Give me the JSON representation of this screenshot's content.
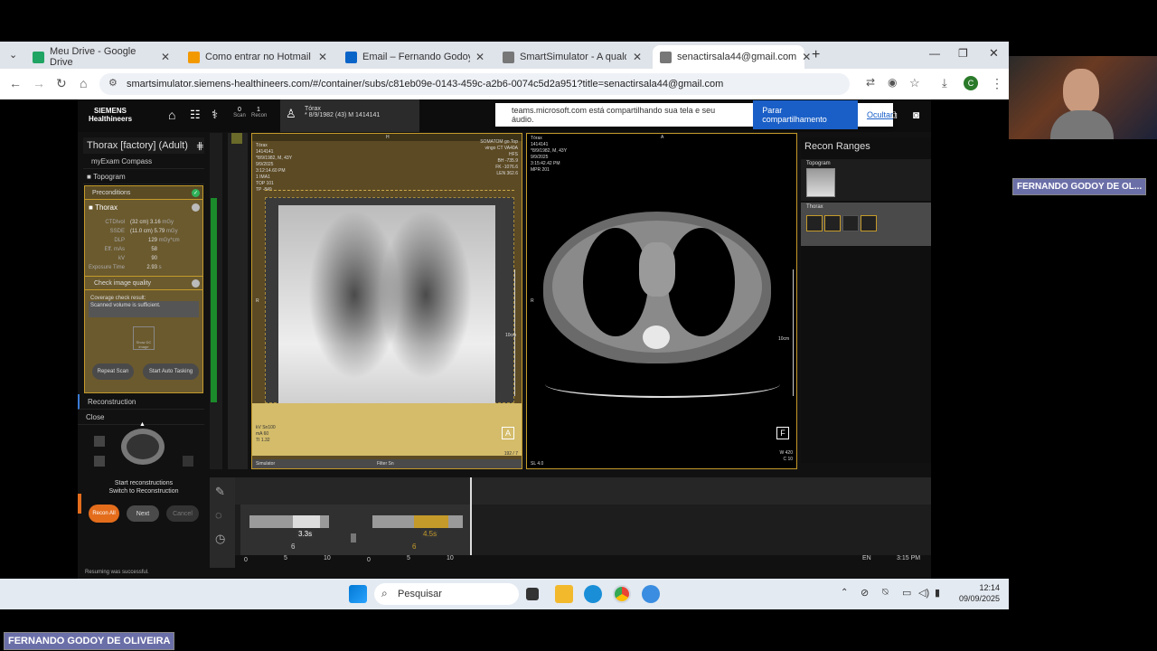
{
  "browser": {
    "tabs": [
      {
        "label": "Meu Drive - Google Drive",
        "color": "#1fa463"
      },
      {
        "label": "Como entrar no Hotmail - Supo",
        "color": "#f29900"
      },
      {
        "label": "Email – Fernando Godoy de Oli",
        "color": "#0a64c8"
      },
      {
        "label": "SmartSimulator - A qualquer ho",
        "color": "#777"
      },
      {
        "label": "senactirsala44@gmail.com",
        "color": "#777"
      }
    ],
    "url": "smartsimulator.siemens-healthineers.com/#/container/subs/c81eb09e-0143-459c-a2b6-0074c5d2a951?title=senactirsala44@gmail.com",
    "profile_initial": "C"
  },
  "app": {
    "brand_line1": "SIEMENS",
    "brand_line2": "Healthineers",
    "scan_count": "0",
    "scan_label": "Scan",
    "recon_count": "1",
    "recon_label": "Recon",
    "patient_title": "Tórax",
    "patient_info": "* 8/9/1982 (43) M 1414141",
    "share_msg": "teams.microsoft.com está compartilhando sua tela e seu áudio.",
    "share_stop": "Parar compartilhamento",
    "share_hide": "Ocultar"
  },
  "left": {
    "protocol": "Thorax [factory] (Adult)",
    "compass": "myExam Compass",
    "topogram": "Topogram",
    "preconditions": "Preconditions",
    "thorax": "Thorax",
    "params": [
      {
        "k": "CTDIvol",
        "v": "(32 cm) 3.16",
        "u": "mGy"
      },
      {
        "k": "SSDE",
        "v": "(11.0 cm) 5.79",
        "u": "mGy"
      },
      {
        "k": "DLP",
        "v": "129",
        "u": "mGy*cm"
      },
      {
        "k": "Eff. mAs",
        "v": "58",
        "u": ""
      },
      {
        "k": "kV",
        "v": "90",
        "u": ""
      },
      {
        "k": "Exposure Time",
        "v": "2.93",
        "u": "s"
      }
    ],
    "check_quality": "Check image quality",
    "coverage_title": "Coverage check result:",
    "coverage_msg": "Scanned volume is sufficient.",
    "show_dc": "Show DC image",
    "repeat_scan": "Repeat Scan",
    "auto_tasking": "Start Auto Tasking",
    "reconstruction": "Reconstruction",
    "close": "Close",
    "start_recons": "Start reconstructions",
    "switch_recon": "Switch to Reconstruction",
    "recon_all": "Recon All",
    "next": "Next",
    "cancel": "Cancel",
    "status": "Resuming was successful."
  },
  "viewer1": {
    "top_label": "H",
    "tl": [
      "Tórax",
      "1414141",
      "*8/9/1982, M, 43Y",
      "9/9/2025",
      "3:12:14.60 PM",
      "1 IMA1",
      "TOP 101",
      "TP -849"
    ],
    "tr": [
      "SOMATOM go.Top",
      "vingo CT VA40A",
      "HFS",
      "",
      "BH -735.9",
      "FK -1076.6",
      "LEN 362.6"
    ],
    "bl": [
      "kV Sn100",
      "mA 60",
      "TI 1.32"
    ],
    "left_label": "R",
    "scale": "10cm",
    "orient": "A",
    "footer_left": "Simulator",
    "footer_mid": "Filter Sn",
    "wc": "192",
    "ww": "7"
  },
  "viewer2": {
    "top_label": "A",
    "tl": [
      "Tórax",
      "1414141",
      "*8/9/1982, M, 43Y",
      "9/9/2025",
      "3:15:42.42 PM",
      "MPR 201"
    ],
    "left_label": "R",
    "scale": "10cm",
    "orient": "F",
    "sl": "SL 4.0",
    "w": "420",
    "c": "10"
  },
  "recon_ranges": {
    "title": "Recon Ranges",
    "topogram": "Topogram",
    "thorax": "Thorax"
  },
  "timeline": {
    "seg1_time": "3.3s",
    "seg1_sub": "6",
    "seg2_time": "4.5s",
    "seg2_sub": "6",
    "axis1": [
      "0",
      "5",
      "10"
    ],
    "axis2": [
      "0",
      "5",
      "10"
    ],
    "clock": "3:15 PM",
    "lang": "EN"
  },
  "taskbar": {
    "search": "Pesquisar",
    "time": "12:14",
    "date": "09/09/2025"
  },
  "meeting": {
    "participant_tag": "FERNANDO GODOY DE OL...",
    "speaker_name": "FERNANDO GODOY DE OLIVEIRA"
  }
}
